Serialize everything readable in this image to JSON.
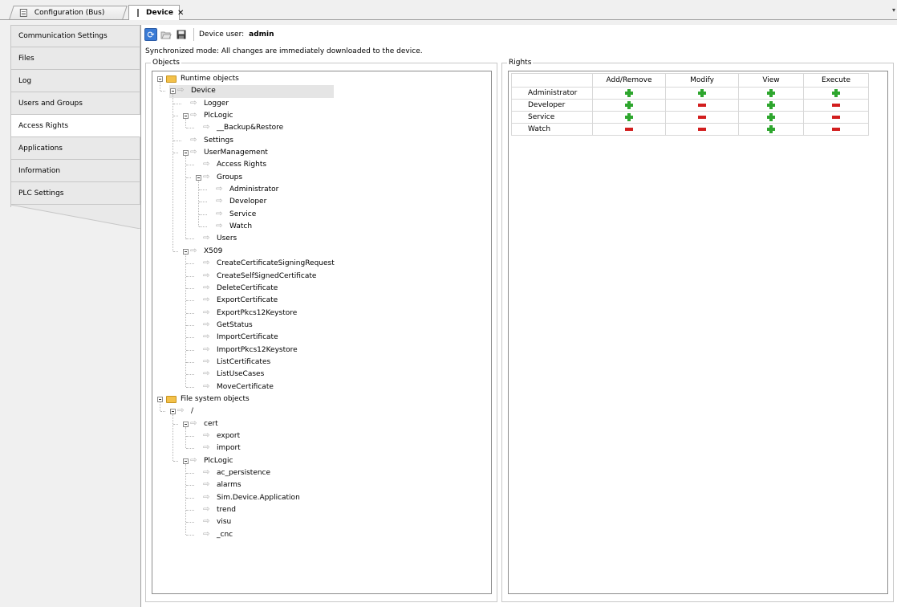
{
  "tabs": [
    {
      "label": "Configuration (Bus)",
      "active": false
    },
    {
      "label": "Device",
      "active": true
    }
  ],
  "side_tabs": [
    {
      "label": "Communication Settings"
    },
    {
      "label": "Files"
    },
    {
      "label": "Log"
    },
    {
      "label": "Users and Groups"
    },
    {
      "label": "Access Rights",
      "active": true
    },
    {
      "label": "Applications"
    },
    {
      "label": "Information"
    },
    {
      "label": "PLC Settings"
    }
  ],
  "toolbar": {
    "device_user_label": "Device user:",
    "device_user_value": "admin"
  },
  "sync_message": "Synchronized mode: All changes are immediately downloaded to the device.",
  "objects": {
    "title": "Objects",
    "tree": [
      {
        "label": "Runtime objects",
        "level": 0,
        "type": "folder"
      },
      {
        "label": "Device",
        "level": 1,
        "type": "arrow",
        "selected": true,
        "expanded": true
      },
      {
        "label": "Logger",
        "level": 2,
        "type": "arrow"
      },
      {
        "label": "PlcLogic",
        "level": 2,
        "type": "arrow",
        "expanded": true
      },
      {
        "label": "__Backup&Restore",
        "level": 3,
        "type": "arrow"
      },
      {
        "label": "Settings",
        "level": 2,
        "type": "arrow"
      },
      {
        "label": "UserManagement",
        "level": 2,
        "type": "arrow",
        "expanded": true
      },
      {
        "label": "Access Rights",
        "level": 3,
        "type": "arrow"
      },
      {
        "label": "Groups",
        "level": 3,
        "type": "arrow",
        "expanded": true
      },
      {
        "label": "Administrator",
        "level": 4,
        "type": "arrow"
      },
      {
        "label": "Developer",
        "level": 4,
        "type": "arrow"
      },
      {
        "label": "Service",
        "level": 4,
        "type": "arrow"
      },
      {
        "label": "Watch",
        "level": 4,
        "type": "arrow"
      },
      {
        "label": "Users",
        "level": 3,
        "type": "arrow"
      },
      {
        "label": "X509",
        "level": 2,
        "type": "arrow",
        "expanded": true
      },
      {
        "label": "CreateCertificateSigningRequest",
        "level": 3,
        "type": "arrow"
      },
      {
        "label": "CreateSelfSignedCertificate",
        "level": 3,
        "type": "arrow"
      },
      {
        "label": "DeleteCertificate",
        "level": 3,
        "type": "arrow"
      },
      {
        "label": "ExportCertificate",
        "level": 3,
        "type": "arrow"
      },
      {
        "label": "ExportPkcs12Keystore",
        "level": 3,
        "type": "arrow"
      },
      {
        "label": "GetStatus",
        "level": 3,
        "type": "arrow"
      },
      {
        "label": "ImportCertificate",
        "level": 3,
        "type": "arrow"
      },
      {
        "label": "ImportPkcs12Keystore",
        "level": 3,
        "type": "arrow"
      },
      {
        "label": "ListCertificates",
        "level": 3,
        "type": "arrow"
      },
      {
        "label": "ListUseCases",
        "level": 3,
        "type": "arrow"
      },
      {
        "label": "MoveCertificate",
        "level": 3,
        "type": "arrow"
      },
      {
        "label": "File system objects",
        "level": 0,
        "type": "folder"
      },
      {
        "label": "/",
        "level": 1,
        "type": "arrow",
        "expanded": true
      },
      {
        "label": "cert",
        "level": 2,
        "type": "arrow",
        "expanded": true
      },
      {
        "label": "export",
        "level": 3,
        "type": "arrow"
      },
      {
        "label": "import",
        "level": 3,
        "type": "arrow"
      },
      {
        "label": "PlcLogic",
        "level": 2,
        "type": "arrow",
        "expanded": true
      },
      {
        "label": "ac_persistence",
        "level": 3,
        "type": "arrow"
      },
      {
        "label": "alarms",
        "level": 3,
        "type": "arrow"
      },
      {
        "label": "Sim.Device.Application",
        "level": 3,
        "type": "arrow"
      },
      {
        "label": "trend",
        "level": 3,
        "type": "arrow"
      },
      {
        "label": "visu",
        "level": 3,
        "type": "arrow"
      },
      {
        "label": "_cnc",
        "level": 3,
        "type": "arrow"
      }
    ]
  },
  "rights": {
    "title": "Rights",
    "columns": [
      "Add/Remove",
      "Modify",
      "View",
      "Execute"
    ],
    "rows": [
      {
        "name": "Administrator",
        "values": [
          "allow",
          "allow",
          "allow",
          "allow"
        ]
      },
      {
        "name": "Developer",
        "values": [
          "allow",
          "deny",
          "allow",
          "deny"
        ]
      },
      {
        "name": "Service",
        "values": [
          "allow",
          "deny",
          "allow",
          "deny"
        ]
      },
      {
        "name": "Watch",
        "values": [
          "deny",
          "deny",
          "allow",
          "deny"
        ]
      }
    ]
  },
  "colors": {
    "allow": "#2ea62e",
    "deny": "#d21e1e",
    "folder": "#f3c14a"
  }
}
